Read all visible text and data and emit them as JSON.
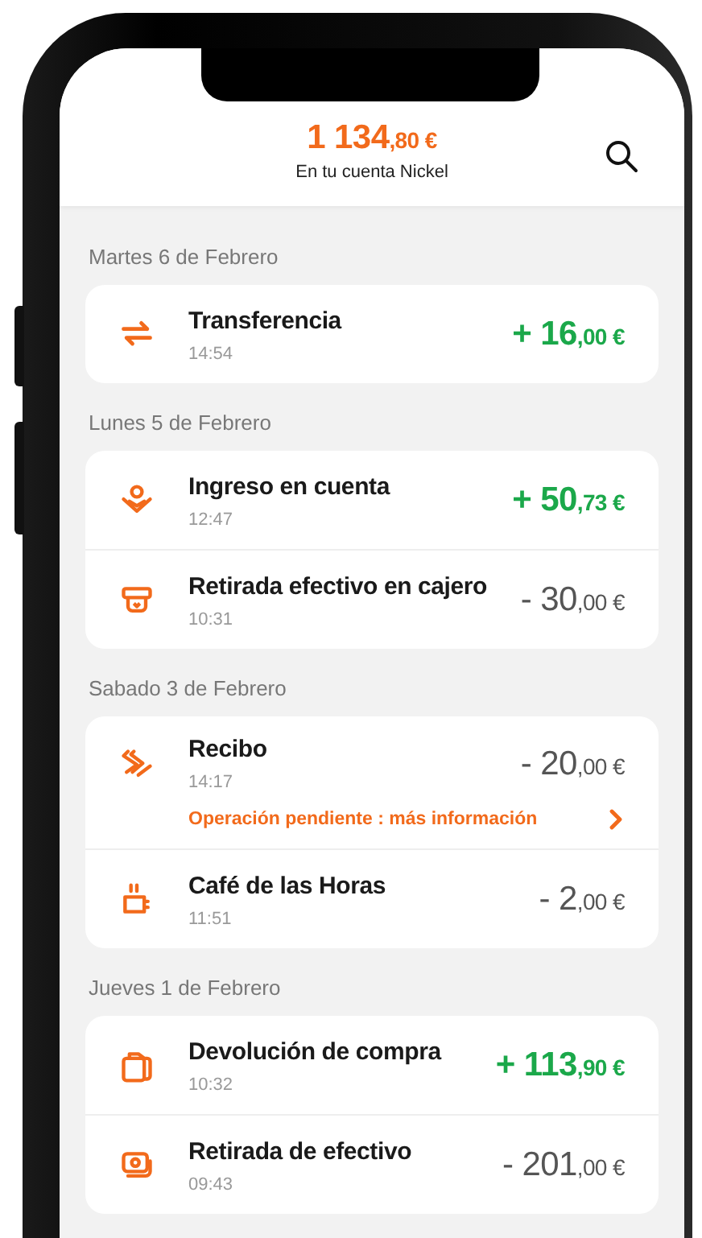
{
  "header": {
    "balance": {
      "main": "1 134",
      "cents": ",80 €"
    },
    "subtitle": "En tu cuenta Nickel"
  },
  "days": [
    {
      "date": "Martes 6 de Febrero",
      "transactions": [
        {
          "kind": "transfer",
          "title": "Transferencia",
          "time": "14:54",
          "credit": true,
          "amount": {
            "main": "+ 16",
            "cents": ",00 €"
          }
        }
      ]
    },
    {
      "date": "Lunes 5 de Febrero",
      "transactions": [
        {
          "kind": "deposit",
          "title": "Ingreso en cuenta",
          "time": "12:47",
          "credit": true,
          "amount": {
            "main": "+ 50",
            "cents": ",73 €"
          }
        },
        {
          "kind": "atm",
          "title": "Retirada efectivo en cajero",
          "time": "10:31",
          "credit": false,
          "amount": {
            "main": "- 30",
            "cents": ",00 €"
          }
        }
      ]
    },
    {
      "date": "Sabado 3 de Febrero",
      "transactions": [
        {
          "kind": "debit",
          "title": "Recibo",
          "time": "14:17",
          "credit": false,
          "amount": {
            "main": "- 20",
            "cents": ",00 €"
          },
          "notice": "Operación pendiente : más información"
        },
        {
          "kind": "coffee",
          "title": "Café de las Horas",
          "time": "11:51",
          "credit": false,
          "amount": {
            "main": "- 2",
            "cents": ",00 €"
          }
        }
      ]
    },
    {
      "date": "Jueves 1 de Febrero",
      "transactions": [
        {
          "kind": "bag",
          "title": "Devolución de compra",
          "time": "10:32",
          "credit": true,
          "amount": {
            "main": "+ 113",
            "cents": ",90 €"
          }
        },
        {
          "kind": "cash",
          "title": "Retirada de efectivo",
          "time": "09:43",
          "credit": false,
          "amount": {
            "main": "- 201",
            "cents": ",00 €"
          }
        }
      ]
    }
  ]
}
